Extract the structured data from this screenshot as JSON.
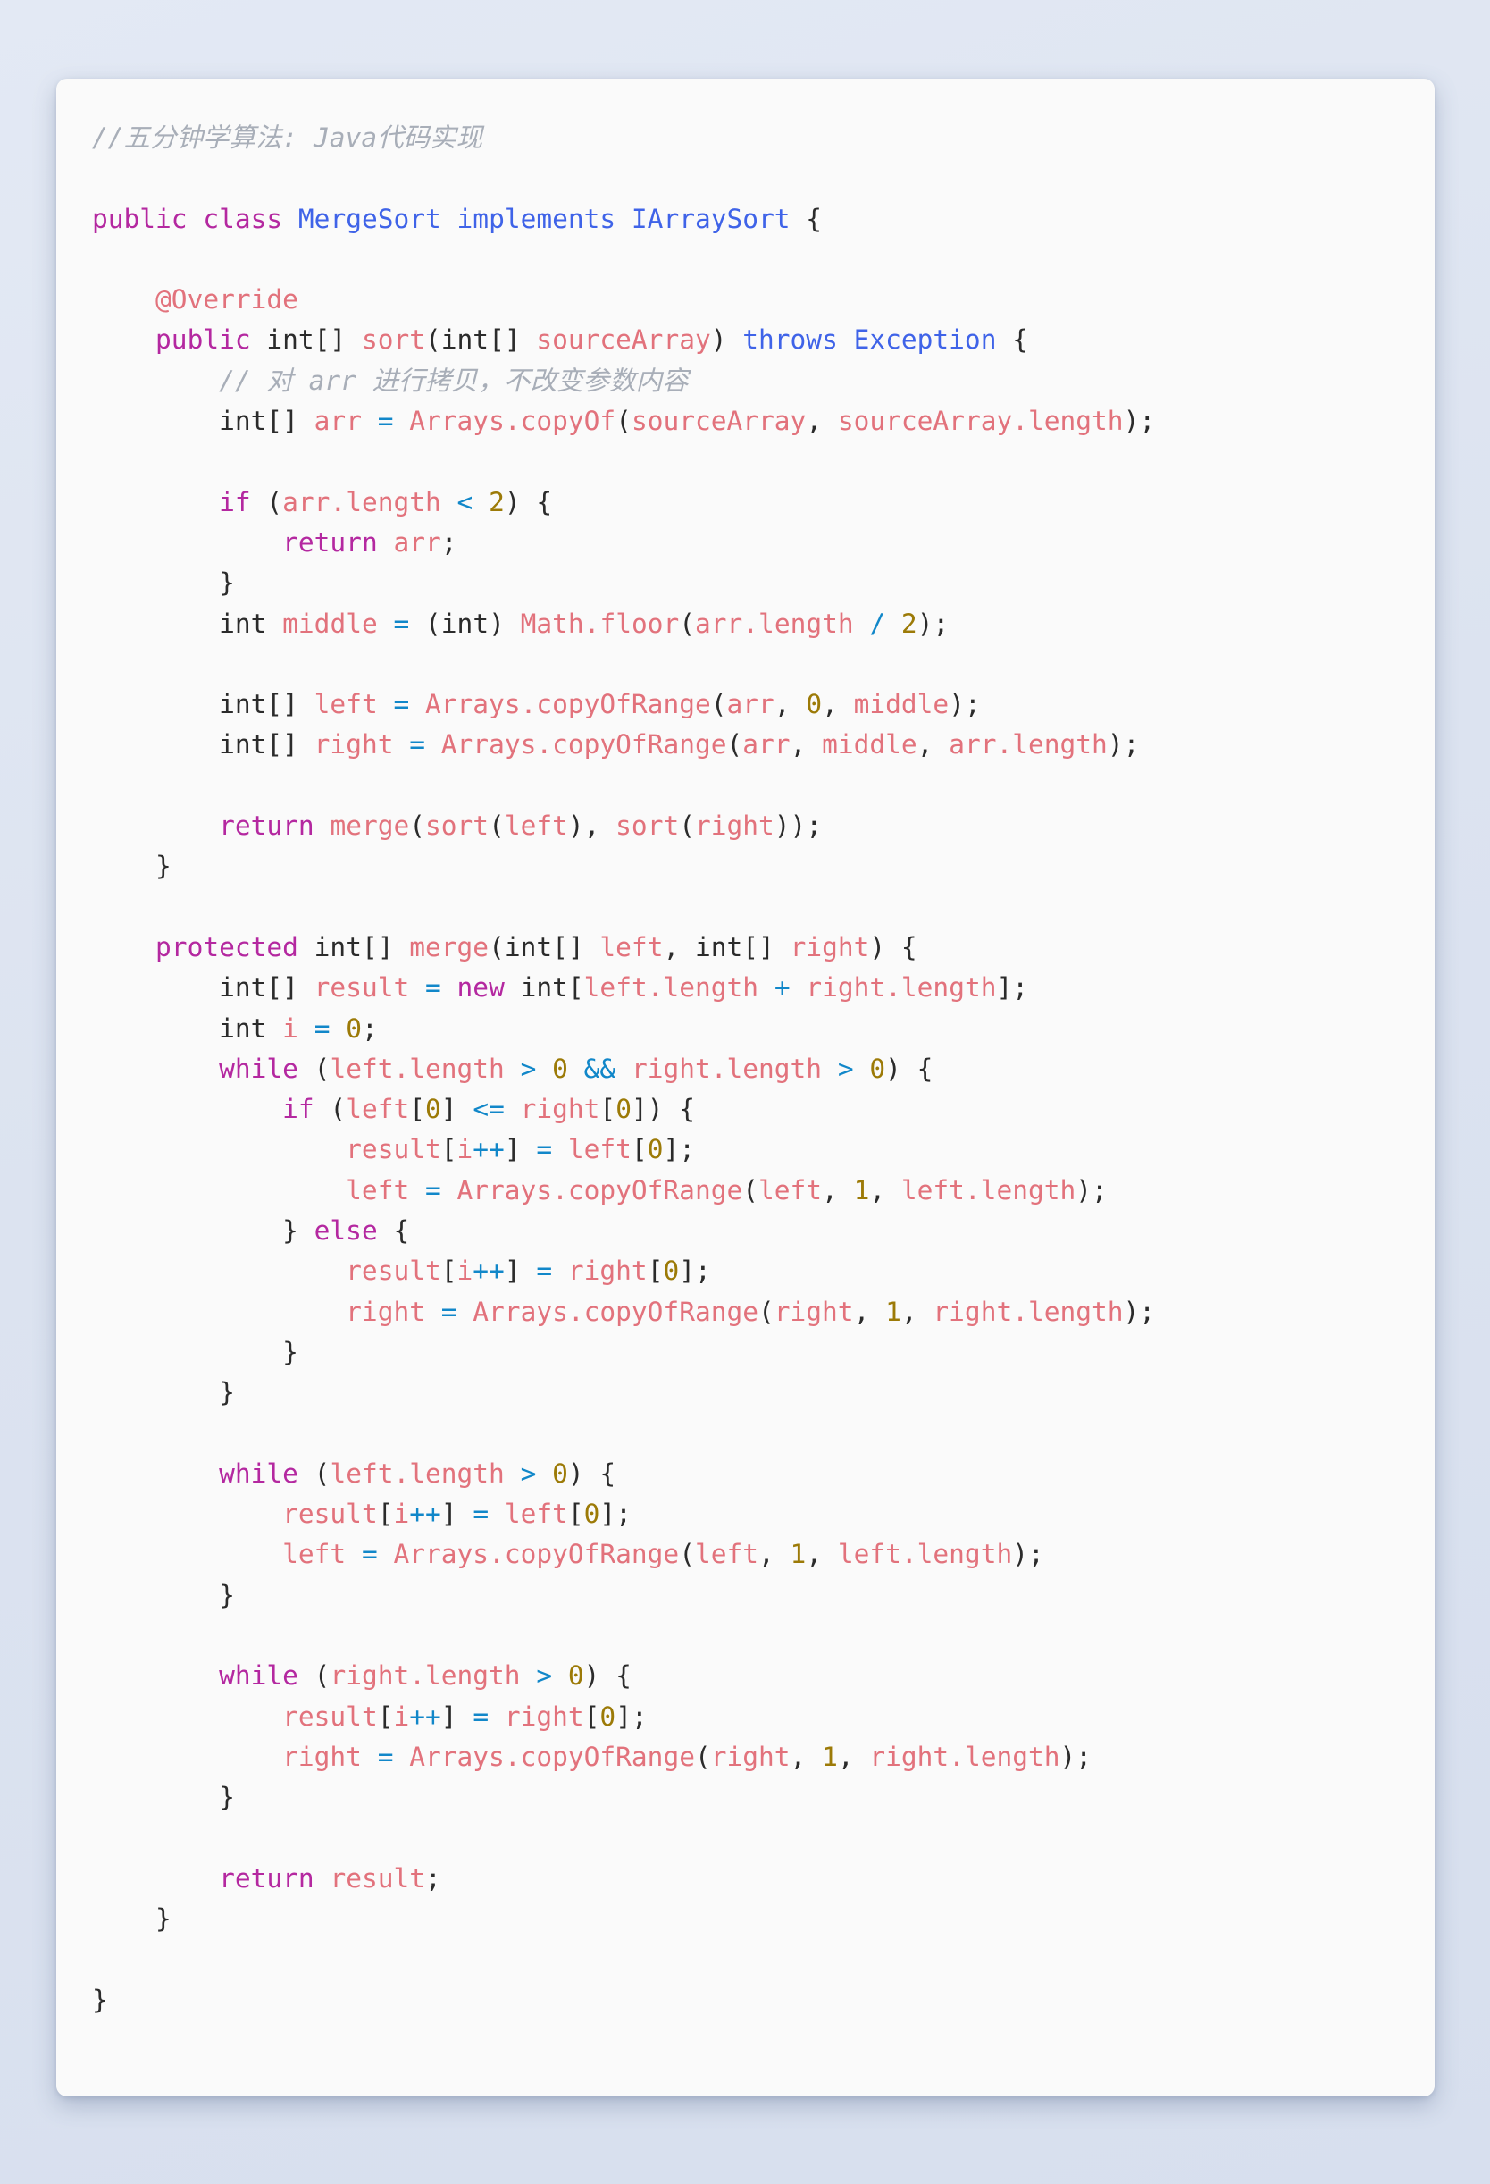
{
  "theme": {
    "background_color": "#dce3f0",
    "card_color": "#fafafa",
    "comment_color": "#a8aeb8",
    "keyword_color": "#b428a0",
    "class_color": "#3f63e8",
    "identifier_color": "#e2727c",
    "number_color": "#9c7a07",
    "operator_color": "#1187c9",
    "text_color": "#2b2b2b"
  },
  "code": {
    "language": "Java",
    "header_comment": "//五分钟学算法: Java代码实现",
    "class_name": "MergeSort",
    "interface_name": "IArraySort",
    "inner_comment": "// 对 arr 进行拷贝，不改变参数内容",
    "lines": [
      "//五分钟学算法: Java代码实现",
      "",
      "public class MergeSort implements IArraySort {",
      "",
      "    @Override",
      "    public int[] sort(int[] sourceArray) throws Exception {",
      "        // 对 arr 进行拷贝，不改变参数内容",
      "        int[] arr = Arrays.copyOf(sourceArray, sourceArray.length);",
      "",
      "        if (arr.length < 2) {",
      "            return arr;",
      "        }",
      "        int middle = (int) Math.floor(arr.length / 2);",
      "",
      "        int[] left = Arrays.copyOfRange(arr, 0, middle);",
      "        int[] right = Arrays.copyOfRange(arr, middle, arr.length);",
      "",
      "        return merge(sort(left), sort(right));",
      "    }",
      "",
      "    protected int[] merge(int[] left, int[] right) {",
      "        int[] result = new int[left.length + right.length];",
      "        int i = 0;",
      "        while (left.length > 0 && right.length > 0) {",
      "            if (left[0] <= right[0]) {",
      "                result[i++] = left[0];",
      "                left = Arrays.copyOfRange(left, 1, left.length);",
      "            } else {",
      "                result[i++] = right[0];",
      "                right = Arrays.copyOfRange(right, 1, right.length);",
      "            }",
      "        }",
      "",
      "        while (left.length > 0) {",
      "            result[i++] = left[0];",
      "            left = Arrays.copyOfRange(left, 1, left.length);",
      "        }",
      "",
      "        while (right.length > 0) {",
      "            result[i++] = right[0];",
      "            right = Arrays.copyOfRange(right, 1, right.length);",
      "        }",
      "",
      "        return result;",
      "    }",
      "",
      "}"
    ]
  }
}
